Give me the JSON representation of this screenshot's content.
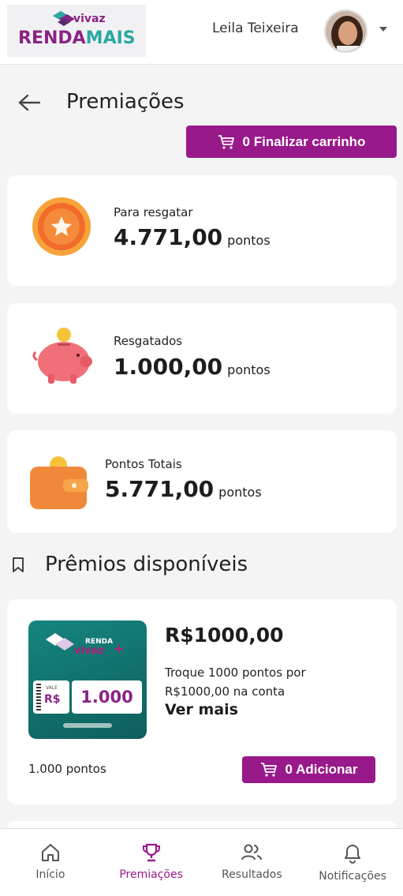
{
  "header": {
    "logo_top": "vivaz",
    "logo_renda": "RENDA",
    "logo_mais": "MAIS",
    "user_name": "Leila Teixeira"
  },
  "page": {
    "title": "Premiações",
    "cart_button": "0 Finalizar carrinho"
  },
  "stats": [
    {
      "label": "Para resgatar",
      "value": "4.771,00",
      "unit": "pontos"
    },
    {
      "label": "Resgatados",
      "value": "1.000,00",
      "unit": "pontos"
    },
    {
      "label": "Pontos Totais",
      "value": "5.771,00",
      "unit": "pontos"
    }
  ],
  "section": {
    "title": "Prêmios disponíveis"
  },
  "prize": {
    "image": {
      "renda": "RENDA",
      "vivaz": "vivaz",
      "vale": "VALE",
      "currency": "R$",
      "amount": "1.000"
    },
    "title": "R$1000,00",
    "description": "Troque 1000 pontos por R$1000,00 na conta",
    "more": "Ver mais",
    "points": "1.000 pontos",
    "add_button": "0 Adicionar"
  },
  "nav": [
    {
      "label": "Início"
    },
    {
      "label": "Premiações"
    },
    {
      "label": "Resultados"
    },
    {
      "label": "Notificações"
    }
  ],
  "colors": {
    "brand_purple": "#98198a",
    "brand_teal": "#29a8a4",
    "background": "#f4f4f4"
  }
}
